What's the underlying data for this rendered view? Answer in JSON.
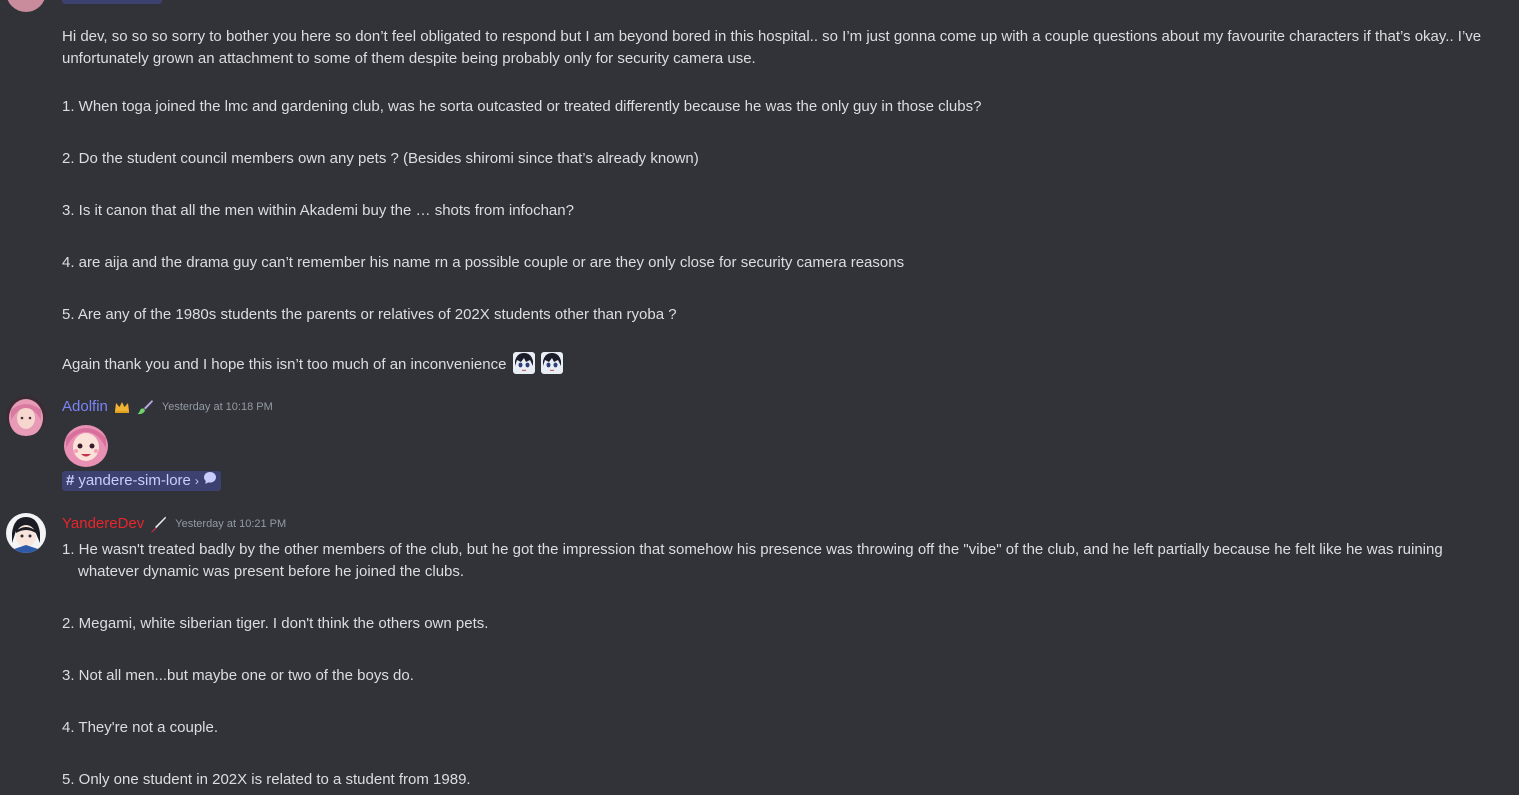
{
  "first_message": {
    "paragraph_line1": "Hi dev, so so so sorry to bother you here so don’t feel obligated to respond but I am beyond bored in this hospital.. so I’m just gonna come up with a couple questions about my favourite characters if that’s okay.. I’ve",
    "paragraph_line2": "unfortunately grown an attachment to some of them despite being probably only for security camera use.",
    "questions": [
      "1. When toga joined the lmc and gardening club, was he sorta outcasted or treated differently because he was the only guy in those clubs?",
      "2. Do the student council members own any pets ? (Besides shiromi since that’s already known)",
      "3. Is it canon that all the men within Akademi buy the … shots from infochan?",
      "4. are aija and the drama guy can’t remember his name rn a possible couple or are they only close for security camera reasons",
      "5. Are any of the 1980s students the parents or relatives of 202X students other than ryoba ?"
    ],
    "closing": "Again thank you and I hope this isn’t too much of an inconvenience"
  },
  "adolfin_message": {
    "username": "Adolfin",
    "timestamp": "Yesterday at 10:18 PM",
    "channel": "yandere-sim-lore",
    "hash": "#",
    "chevron": "›"
  },
  "dev_message": {
    "username": "YandereDev",
    "timestamp": "Yesterday at 10:21 PM",
    "answer1_line1": "1. He wasn't treated badly by the other members of the club, but he got the impression that somehow his presence was throwing off the \"vibe\" of the club, and he left partially because he felt like he was ruining",
    "answer1_line2": "whatever dynamic was present before he joined the clubs.",
    "answers": [
      "2. Megami, white siberian tiger. I don't think the others own pets.",
      "3. Not all men...but maybe one or two of the boys do.",
      "4. They're not a couple.",
      "5. Only one student in 202X is related to a student from 1989."
    ]
  },
  "colors": {
    "background": "#313338",
    "text": "#dbdee1",
    "adolfin_name": "#7b83f5",
    "dev_name": "#e8252b",
    "timestamp": "#949ba4",
    "mention_bg": "rgba(88,101,242,0.30)"
  },
  "icons": {
    "adolfin_badges": [
      "crown-icon",
      "paintbrush-icon"
    ],
    "dev_badge": "knife-icon",
    "closing_emojis": [
      "anime-girl-emoji",
      "anime-girl-emoji"
    ],
    "thread_icon": "chat-bubble-icon"
  }
}
